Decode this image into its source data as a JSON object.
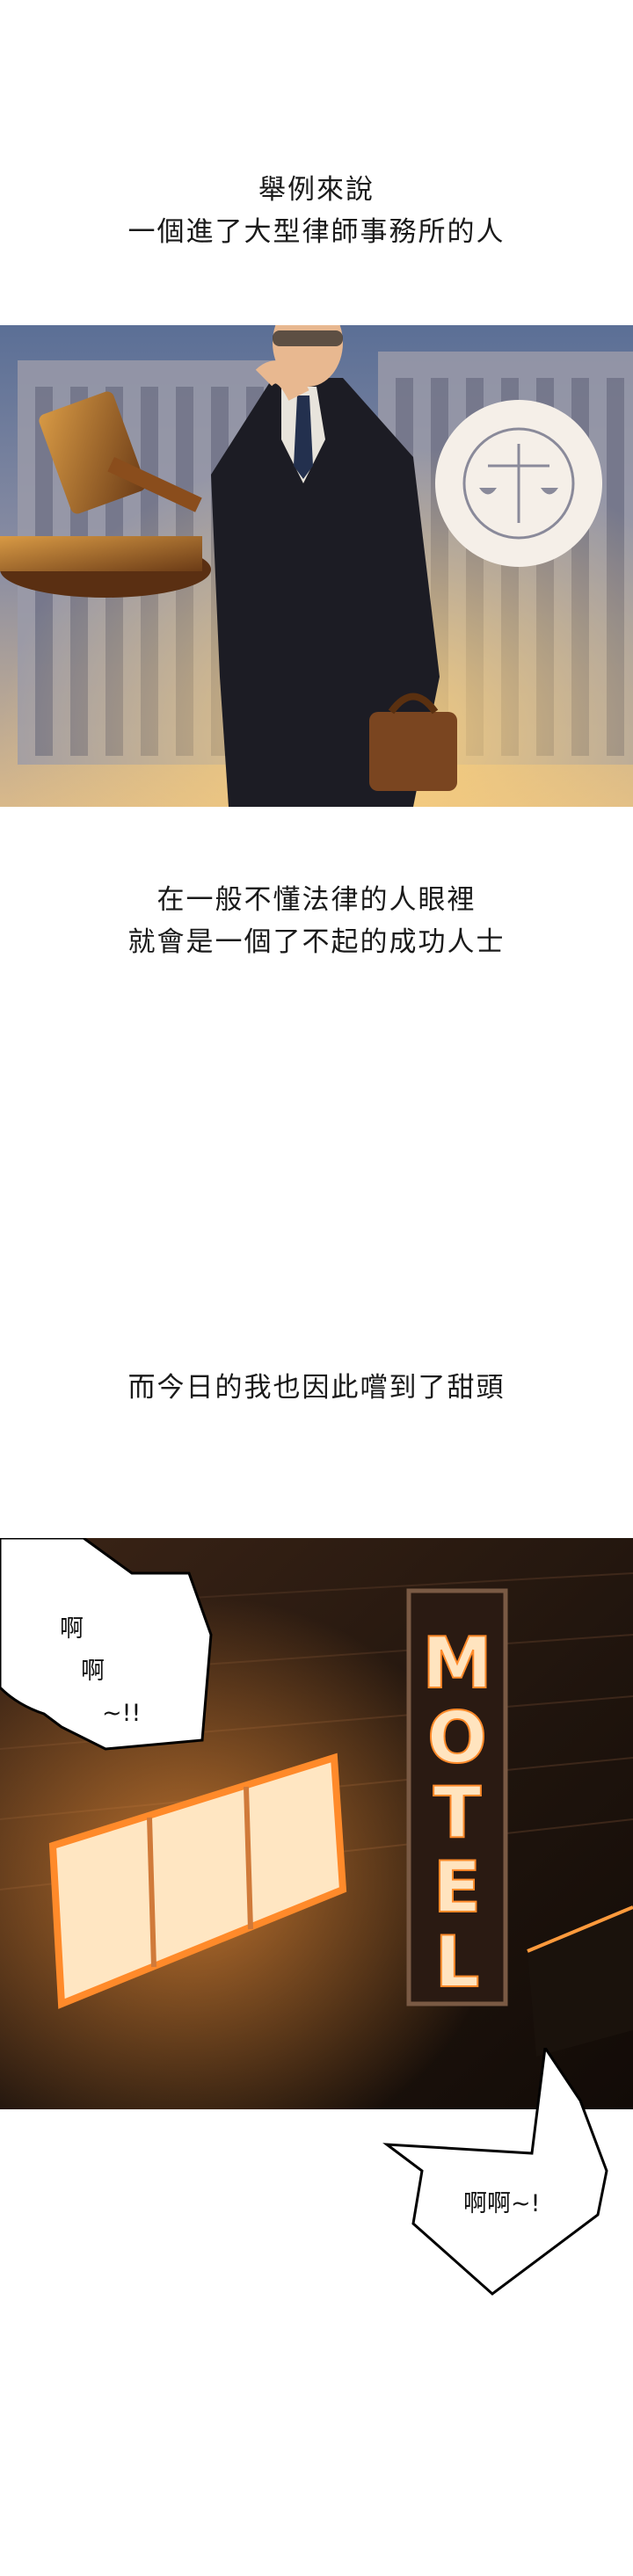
{
  "captions": {
    "line1": "舉例來說",
    "line2": "一個進了大型律師事務所的人",
    "line3": "在一般不懂法律的人眼裡",
    "line4": "就會是一個了不起的成功人士",
    "line5": "而今日的我也因此嚐到了甜頭"
  },
  "panel2": {
    "sign_letters": [
      "M",
      "O",
      "T",
      "E",
      "L"
    ]
  },
  "bubbles": {
    "b1_line1": "啊",
    "b1_line2": "啊",
    "b1_line3": "~!!",
    "b2": "啊啊~!"
  },
  "colors": {
    "sign_glow": "#ffb060",
    "panel2_bg": "#2a1a10"
  }
}
